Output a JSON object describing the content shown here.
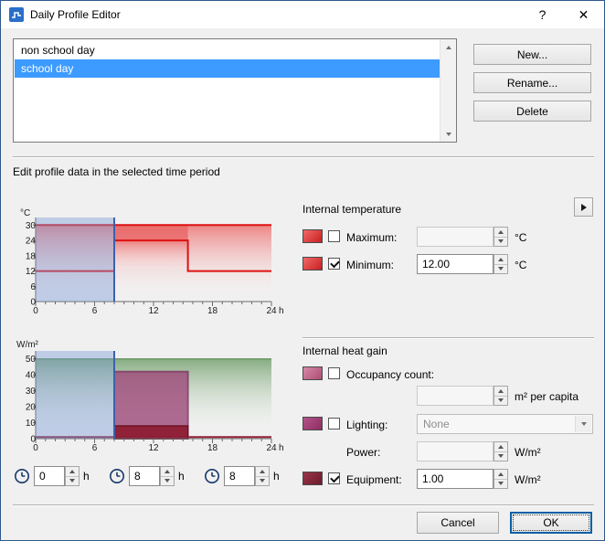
{
  "colors": {
    "window_border": "#30588c",
    "titlebar_bg": "#ffffff",
    "dialog_bg": "#f0f0f0",
    "list_selection": "#3d9bff",
    "selection_overlay_blue": "#7d9bd7",
    "temperature_line_red": "#dd1111",
    "temperature_fill_red": "#ec6a6a",
    "heat_gain_fill_green": "#74a06e",
    "occupancy_bar_purple": "#9e4a7a",
    "equipment_bar_maroon": "#8f2138",
    "maximum_swatch": "#d92b2b",
    "minimum_swatch": "#d92b2b",
    "occupancy_swatch": "#c4718f",
    "lighting_swatch": "#a23a70",
    "equipment_swatch": "#7c1f33",
    "default_button_border": "#0b5fa4"
  },
  "window": {
    "title": "Daily Profile Editor",
    "help_label": "?",
    "close_label": "✕"
  },
  "profile_list": {
    "items": [
      {
        "label": "non school day",
        "selected": false
      },
      {
        "label": "school day",
        "selected": true
      }
    ]
  },
  "actions": {
    "new_label": "New...",
    "rename_label": "Rename...",
    "delete_label": "Delete"
  },
  "section_label": "Edit profile data in the selected time period",
  "charts": {
    "temperature": {
      "y_unit": "°C",
      "y_ticks": [
        "30",
        "24",
        "18",
        "12",
        "6",
        "0"
      ],
      "x_ticks": [
        "0",
        "6",
        "12",
        "18",
        "24"
      ],
      "x_unit": "h"
    },
    "heat_gain": {
      "y_unit": "W/m²",
      "y_ticks": [
        "50",
        "40",
        "30",
        "20",
        "10",
        "0"
      ],
      "x_ticks": [
        "0",
        "6",
        "12",
        "18",
        "24"
      ],
      "x_unit": "h"
    }
  },
  "chart_data": [
    {
      "type": "area",
      "title": "Internal temperature profile",
      "x_unit": "h",
      "y_unit": "°C",
      "xlim": [
        0,
        24
      ],
      "ylim": [
        0,
        33
      ],
      "selected_period_h": [
        0,
        8
      ],
      "series": [
        {
          "name": "maximum",
          "steps": [
            {
              "from_h": 0,
              "to_h": 24,
              "value": 30
            }
          ]
        },
        {
          "name": "minimum",
          "steps": [
            {
              "from_h": 0,
              "to_h": 8,
              "value": 12
            },
            {
              "from_h": 8,
              "to_h": 15.5,
              "value": 24
            },
            {
              "from_h": 15.5,
              "to_h": 24,
              "value": 12
            }
          ]
        }
      ]
    },
    {
      "type": "bar",
      "title": "Internal heat gain profile",
      "x_unit": "h",
      "y_unit": "W/m²",
      "xlim": [
        0,
        24
      ],
      "ylim": [
        0,
        55
      ],
      "selected_period_h": [
        0,
        8
      ],
      "series": [
        {
          "name": "occupancy-lighting",
          "steps": [
            {
              "from_h": 8,
              "to_h": 15.5,
              "value": 42
            }
          ]
        },
        {
          "name": "equipment",
          "steps": [
            {
              "from_h": 0,
              "to_h": 8,
              "value": 1
            },
            {
              "from_h": 8,
              "to_h": 15.5,
              "value": 8
            },
            {
              "from_h": 15.5,
              "to_h": 24,
              "value": 1
            }
          ]
        }
      ]
    }
  ],
  "time_controls": [
    {
      "value": "0",
      "unit": "h"
    },
    {
      "value": "8",
      "unit": "h"
    },
    {
      "value": "8",
      "unit": "h"
    }
  ],
  "temperature_section": {
    "title": "Internal temperature",
    "maximum": {
      "label": "Maximum:",
      "value": "",
      "unit": "°C",
      "checked": false
    },
    "minimum": {
      "label": "Minimum:",
      "value": "12.00",
      "unit": "°C",
      "checked": true
    }
  },
  "heat_gain_section": {
    "title": "Internal heat gain",
    "occupancy": {
      "label": "Occupancy count:",
      "value": "",
      "unit": "m² per capita",
      "checked": false
    },
    "lighting": {
      "label": "Lighting:",
      "value": "None",
      "checked": false
    },
    "power": {
      "label": "Power:",
      "value": "",
      "unit": "W/m²"
    },
    "equipment": {
      "label": "Equipment:",
      "value": "1.00",
      "unit": "W/m²",
      "checked": true
    }
  },
  "footer": {
    "cancel_label": "Cancel",
    "ok_label": "OK"
  }
}
